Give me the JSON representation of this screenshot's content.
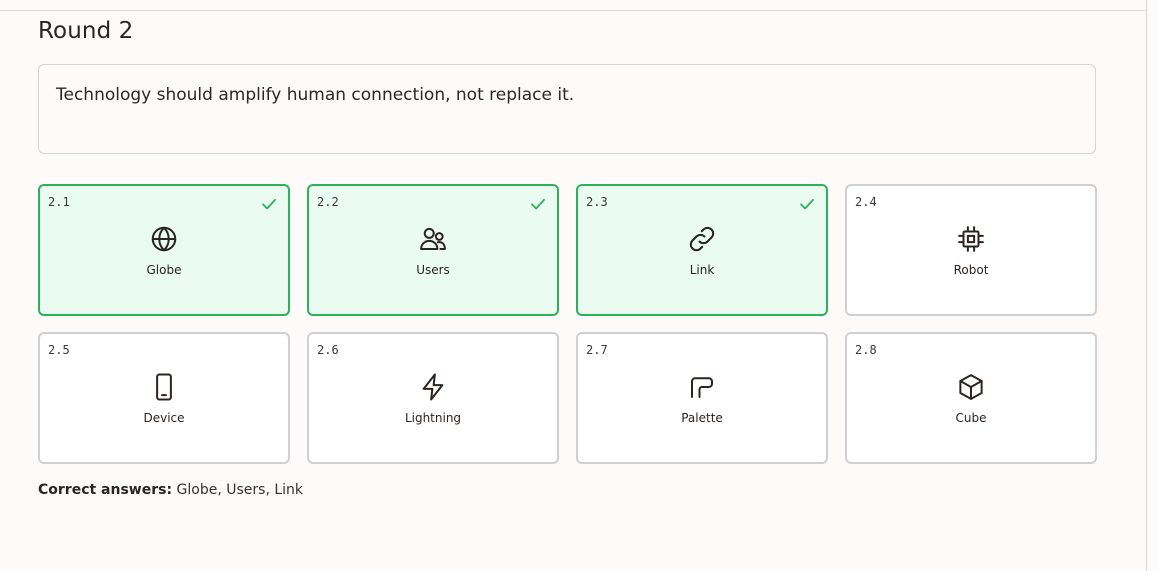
{
  "round": {
    "title": "Round 2"
  },
  "prompt": {
    "text": "Technology should amplify human connection, not replace it."
  },
  "options": [
    {
      "num": "2.1",
      "label": "Globe",
      "icon": "globe-icon",
      "selected": true
    },
    {
      "num": "2.2",
      "label": "Users",
      "icon": "users-icon",
      "selected": true
    },
    {
      "num": "2.3",
      "label": "Link",
      "icon": "link-icon",
      "selected": true
    },
    {
      "num": "2.4",
      "label": "Robot",
      "icon": "chip-icon",
      "selected": false
    },
    {
      "num": "2.5",
      "label": "Device",
      "icon": "phone-icon",
      "selected": false
    },
    {
      "num": "2.6",
      "label": "Lightning",
      "icon": "lightning-icon",
      "selected": false
    },
    {
      "num": "2.7",
      "label": "Palette",
      "icon": "palette-icon",
      "selected": false
    },
    {
      "num": "2.8",
      "label": "Cube",
      "icon": "cube-icon",
      "selected": false
    }
  ],
  "answers": {
    "label": "Correct answers:",
    "value": "Globe, Users, Link"
  },
  "colors": {
    "selected_border": "#2fb15a",
    "selected_bg": "#eafbf1",
    "check": "#2fb15a"
  }
}
